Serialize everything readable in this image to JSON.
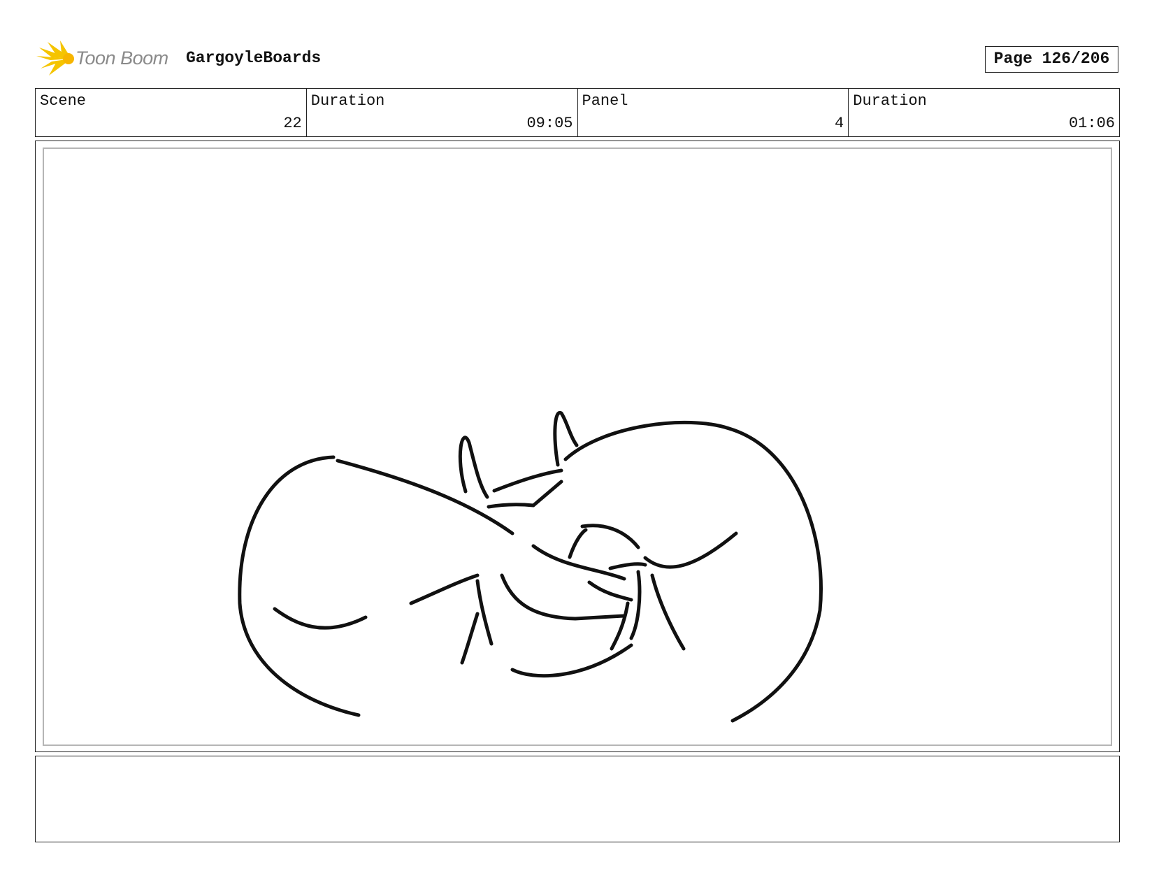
{
  "header": {
    "logo_text": "Toon Boom",
    "project_title": "GargoyleBoards",
    "page_label": "Page 126/206"
  },
  "info": [
    {
      "label": "Scene",
      "value": "22"
    },
    {
      "label": "Duration",
      "value": "09:05"
    },
    {
      "label": "Panel",
      "value": "4"
    },
    {
      "label": "Duration",
      "value": "01:06"
    }
  ],
  "panel": {
    "drawing": "line-drawing-sketch"
  },
  "notes": {
    "text": ""
  },
  "colors": {
    "logo_accent": "#f5c400",
    "border": "#222222",
    "inner_frame": "#b5b5b5",
    "ink": "#111111"
  }
}
